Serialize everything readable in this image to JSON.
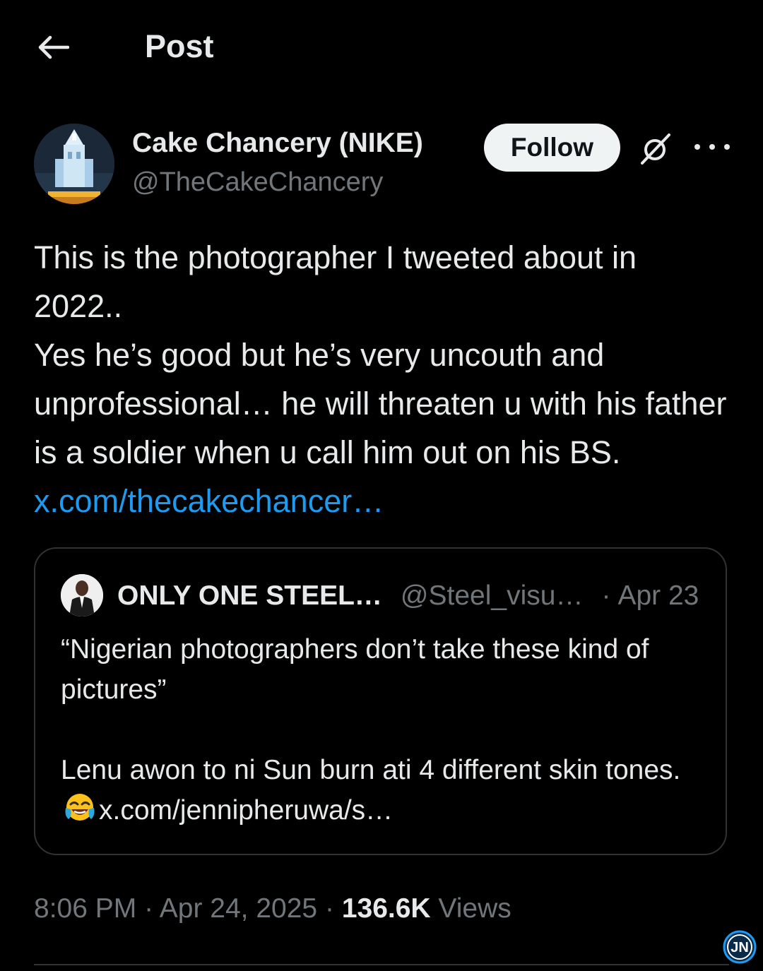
{
  "header": {
    "title": "Post"
  },
  "author": {
    "display_name": "Cake Chancery (NIKE)",
    "handle": "@TheCakeChancery",
    "follow_label": "Follow"
  },
  "post": {
    "text_line1": "This is the photographer I tweeted about in 2022..",
    "text_line2": "Yes he’s good but he’s very uncouth and unprofessional… he will threaten u with his father is a soldier when u call him out on his BS.",
    "link_text": "x.com/thecakechancer…"
  },
  "quote": {
    "name": "ONLY ONE STEEL…",
    "handle": "@Steel_visu…",
    "separator": "·",
    "date": "Apr 23",
    "text_para1": "“Nigerian photographers don’t take these kind of pictures”",
    "text_para2_start": "Lenu awon to ni Sun burn ati 4 different skin tones.",
    "emoji": "face-with-tears-of-joy",
    "link_text": "x.com/jennipheruwa/s…"
  },
  "meta": {
    "time": "8:06 PM",
    "date": "Apr 24, 2025",
    "separator": "·",
    "views_count": "136.6K",
    "views_label": "Views"
  },
  "watermark": {
    "text": "JN"
  },
  "colors": {
    "background": "#000000",
    "text_primary": "#e7e9ea",
    "text_secondary": "#71767b",
    "link": "#1d9bf0",
    "border": "#2f3336",
    "follow_bg": "#eff3f4"
  }
}
